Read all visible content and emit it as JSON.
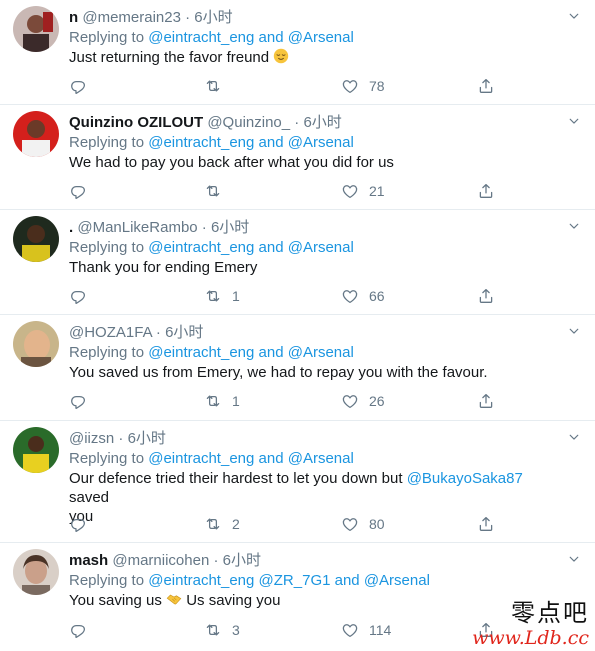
{
  "reply_prefix": "Replying to",
  "and_word": "and",
  "tweets": [
    {
      "name": "n",
      "handle": "@memerain23",
      "time": "6小时",
      "mentions": [
        "@eintracht_eng",
        "@Arsenal"
      ],
      "text": "Just returning the favor freund",
      "emoji": "relieved-face",
      "replies": "",
      "retweets": "",
      "likes": "78"
    },
    {
      "name": "Quinzino OZILOUT",
      "handle": "@Quinzino_",
      "time": "6小时",
      "mentions": [
        "@eintracht_eng",
        "@Arsenal"
      ],
      "text": "We had to pay you back after what you did for us",
      "replies": "",
      "retweets": "",
      "likes": "21"
    },
    {
      "name": ".",
      "handle": "@ManLikeRambo",
      "time": "6小时",
      "mentions": [
        "@eintracht_eng",
        "@Arsenal"
      ],
      "text": "Thank you for ending Emery",
      "replies": "",
      "retweets": "1",
      "likes": "66"
    },
    {
      "name": "",
      "handle": "@HOZA1FA",
      "time": "6小时",
      "mentions": [
        "@eintracht_eng",
        "@Arsenal"
      ],
      "text": "You saved us from Emery, we had to repay you with the favour.",
      "replies": "",
      "retweets": "1",
      "likes": "26"
    },
    {
      "name": "",
      "handle": "@iizsn",
      "time": "6小时",
      "mentions": [
        "@eintracht_eng",
        "@Arsenal"
      ],
      "text_before": "Our defence tried their hardest to let you down but",
      "text_mention": "@BukayoSaka87",
      "text_after": "saved",
      "text_line2": "you",
      "replies": "",
      "retweets": "2",
      "likes": "80"
    },
    {
      "name": "mash",
      "handle": "@marniicohen",
      "time": "6小时",
      "mentions": [
        "@eintracht_eng",
        "@ZR_7G1",
        "@Arsenal"
      ],
      "text_before": "You saving us",
      "text_after": "Us saving you",
      "emoji": "handshake",
      "replies": "",
      "retweets": "3",
      "likes": "114"
    }
  ],
  "watermark": {
    "cn": "零点吧",
    "url": "www.Ldb.cc"
  },
  "colors": {
    "link": "#1b95e0",
    "muted": "#657786",
    "text": "#14171a",
    "divider": "#e6ecf0",
    "watermark_red": "#e0251b"
  }
}
